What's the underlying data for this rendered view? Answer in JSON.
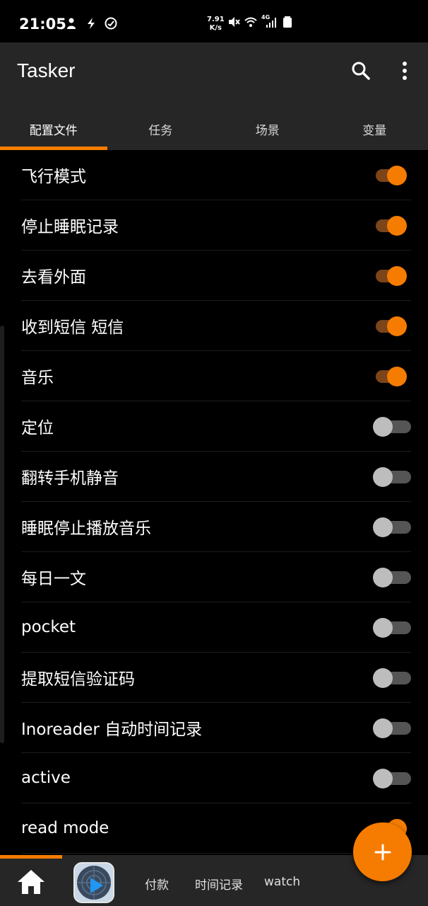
{
  "status_bar": {
    "time": "21:05",
    "net_speed_value": "7.91",
    "net_speed_unit": "K/s",
    "network_type": "4G"
  },
  "app": {
    "title": "Tasker"
  },
  "tabs": [
    {
      "label": "配置文件",
      "active": true
    },
    {
      "label": "任务",
      "active": false
    },
    {
      "label": "场景",
      "active": false
    },
    {
      "label": "变量",
      "active": false
    }
  ],
  "profiles": [
    {
      "label": "飞行模式",
      "enabled": true
    },
    {
      "label": "停止睡眠记录",
      "enabled": true
    },
    {
      "label": "去看外面",
      "enabled": true
    },
    {
      "label": "收到短信 短信",
      "enabled": true
    },
    {
      "label": "音乐",
      "enabled": true
    },
    {
      "label": "定位",
      "enabled": false
    },
    {
      "label": "翻转手机静音",
      "enabled": false
    },
    {
      "label": "睡眠停止播放音乐",
      "enabled": false
    },
    {
      "label": "每日一文",
      "enabled": false
    },
    {
      "label": "pocket",
      "enabled": false
    },
    {
      "label": "提取短信验证码",
      "enabled": false
    },
    {
      "label": "Inoreader 自动时间记录",
      "enabled": false
    },
    {
      "label": "active",
      "enabled": false
    },
    {
      "label": "read mode",
      "enabled": true
    }
  ],
  "bottom_bar": {
    "items": [
      "付款",
      "时间记录",
      "watch"
    ]
  },
  "colors": {
    "accent": "#f57c00",
    "appbar": "#262626",
    "background": "#000000"
  }
}
